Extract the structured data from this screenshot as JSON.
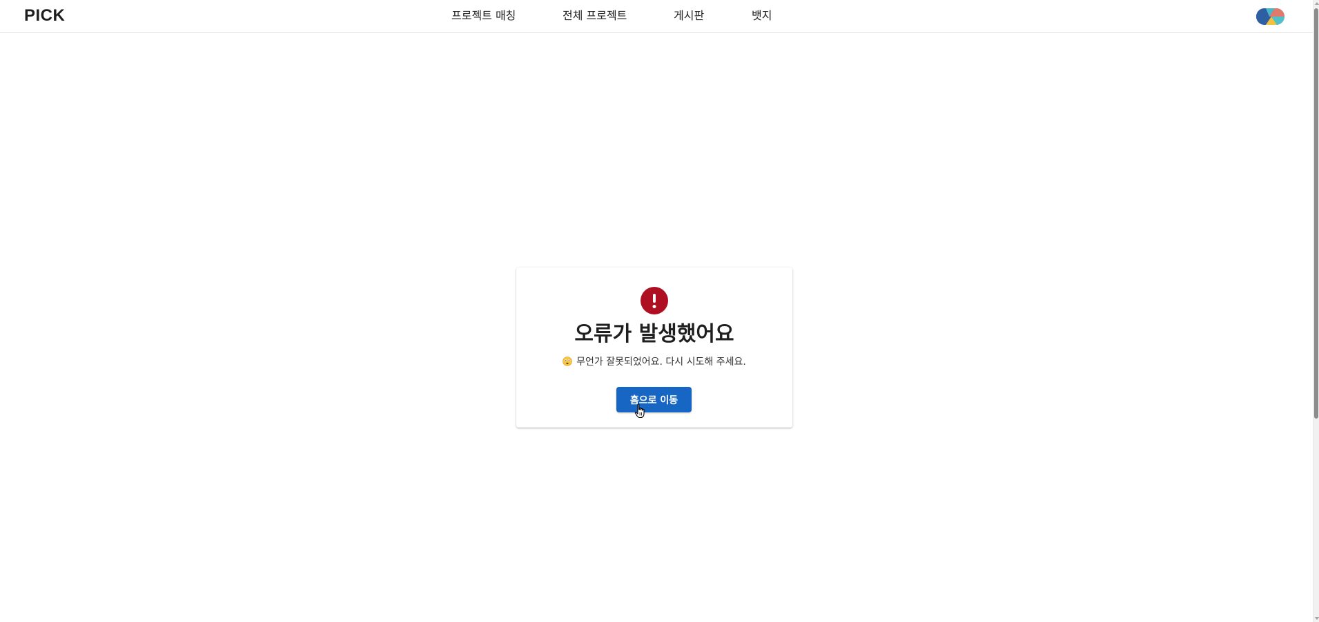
{
  "header": {
    "logo": "PICK",
    "nav": [
      {
        "label": "프로젝트 매칭"
      },
      {
        "label": "전체 프로젝트"
      },
      {
        "label": "게시판"
      },
      {
        "label": "뱃지"
      }
    ],
    "avatar_icon": "user-avatar-icon"
  },
  "error_card": {
    "icon": "exclamation-circle-icon",
    "icon_color": "#ae1021",
    "title": "오류가 발생했어요",
    "emoji_icon": "worried-face-emoji-icon",
    "message": "무언가 잘못되었어요. 다시 시도해 주세요.",
    "button_label": "홈으로 이동",
    "button_color": "#1766c4"
  },
  "pointer": "hand-pointer-cursor-icon"
}
